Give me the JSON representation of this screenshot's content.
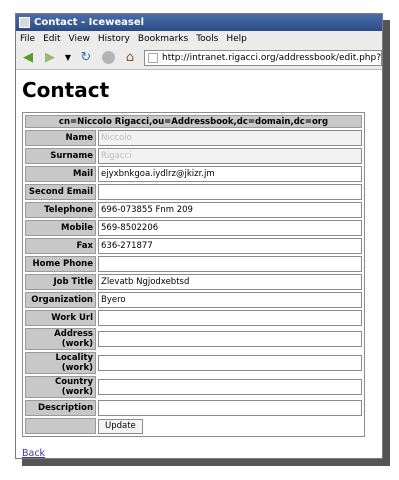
{
  "window": {
    "title": "Contact - Iceweasel"
  },
  "menu": [
    "File",
    "Edit",
    "View",
    "History",
    "Bookmarks",
    "Tools",
    "Help"
  ],
  "toolbar": {
    "url": "http://intranet.rigacci.org/addressbook/edit.php?dn="
  },
  "page": {
    "heading": "Contact",
    "dn": "cn=Niccolo Rigacci,ou=Addressbook,dc=domain,dc=org",
    "fields": [
      {
        "label": "Name",
        "value": "Niccolo",
        "readonly": true
      },
      {
        "label": "Surname",
        "value": "Rigacci",
        "readonly": true
      },
      {
        "label": "Mail",
        "value": "ejyxbnkgoa.iydlrz@jkizr.jm"
      },
      {
        "label": "Second Email",
        "value": ""
      },
      {
        "label": "Telephone",
        "value": "696-073855 Fnm 209"
      },
      {
        "label": "Mobile",
        "value": "569-8502206"
      },
      {
        "label": "Fax",
        "value": "636-271877"
      },
      {
        "label": "Home Phone",
        "value": ""
      },
      {
        "label": "Job Title",
        "value": "Zlevatb Ngjodxebtsd"
      },
      {
        "label": "Organization",
        "value": "Byero"
      },
      {
        "label": "Work Url",
        "value": ""
      },
      {
        "label": "Address (work)",
        "value": ""
      },
      {
        "label": "Locality (work)",
        "value": ""
      },
      {
        "label": "Country (work)",
        "value": ""
      },
      {
        "label": "Description",
        "value": ""
      }
    ],
    "update_label": "Update",
    "back_label": "Back"
  }
}
